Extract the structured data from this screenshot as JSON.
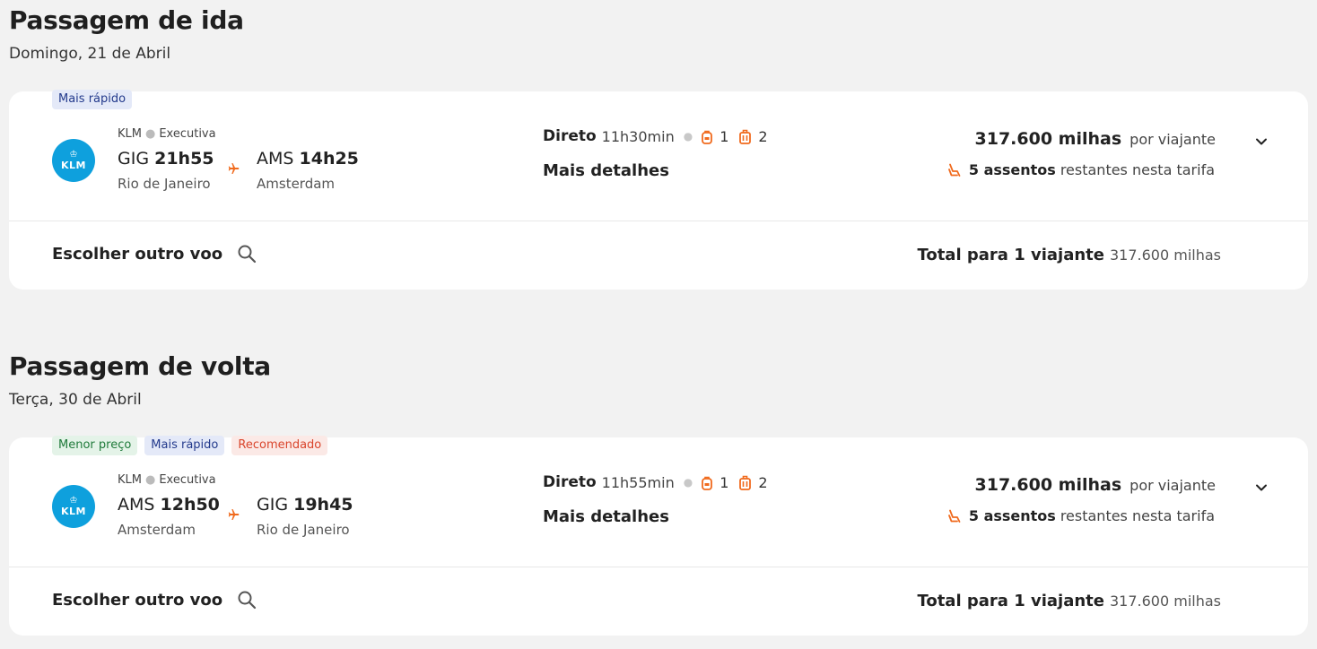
{
  "outbound": {
    "title": "Passagem de ida",
    "date": "Domingo, 21 de Abril",
    "badges": [
      {
        "label": "Mais rápido",
        "color": "blue"
      }
    ],
    "airline": "KLM",
    "cabin": "Executiva",
    "logo_text": "KLM",
    "origin": {
      "code": "GIG",
      "time": "21h55",
      "city": "Rio de Janeiro"
    },
    "destination": {
      "code": "AMS",
      "time": "14h25",
      "city": "Amsterdam"
    },
    "stops_label": "Direto",
    "duration": "11h30min",
    "carry_on": "1",
    "checked_bags": "2",
    "details_label": "Mais detalhes",
    "price": "317.600 milhas",
    "price_unit": "por viajante",
    "seats_count": "5 assentos",
    "seats_text": "restantes nesta tarifa",
    "choose_label": "Escolher outro voo",
    "total_label": "Total para 1 viajante",
    "total_value": "317.600 milhas"
  },
  "return": {
    "title": "Passagem de volta",
    "date": "Terça, 30 de Abril",
    "badges": [
      {
        "label": "Menor preço",
        "color": "green"
      },
      {
        "label": "Mais rápido",
        "color": "blue"
      },
      {
        "label": "Recomendado",
        "color": "red"
      }
    ],
    "airline": "KLM",
    "cabin": "Executiva",
    "logo_text": "KLM",
    "origin": {
      "code": "AMS",
      "time": "12h50",
      "city": "Amsterdam"
    },
    "destination": {
      "code": "GIG",
      "time": "19h45",
      "city": "Rio de Janeiro"
    },
    "stops_label": "Direto",
    "duration": "11h55min",
    "carry_on": "1",
    "checked_bags": "2",
    "details_label": "Mais detalhes",
    "price": "317.600 milhas",
    "price_unit": "por viajante",
    "seats_count": "5 assentos",
    "seats_text": "restantes nesta tarifa",
    "choose_label": "Escolher outro voo",
    "total_label": "Total para 1 viajante",
    "total_value": "317.600 milhas"
  },
  "colors": {
    "accent_orange": "#f06a1d",
    "klm_blue": "#0ea0dd"
  },
  "icons": {
    "plane": "plane-icon",
    "carry_on": "backpack-icon",
    "checked": "suitcase-icon",
    "seat": "seat-icon",
    "expand": "chevron-down-icon",
    "search": "search-icon"
  }
}
